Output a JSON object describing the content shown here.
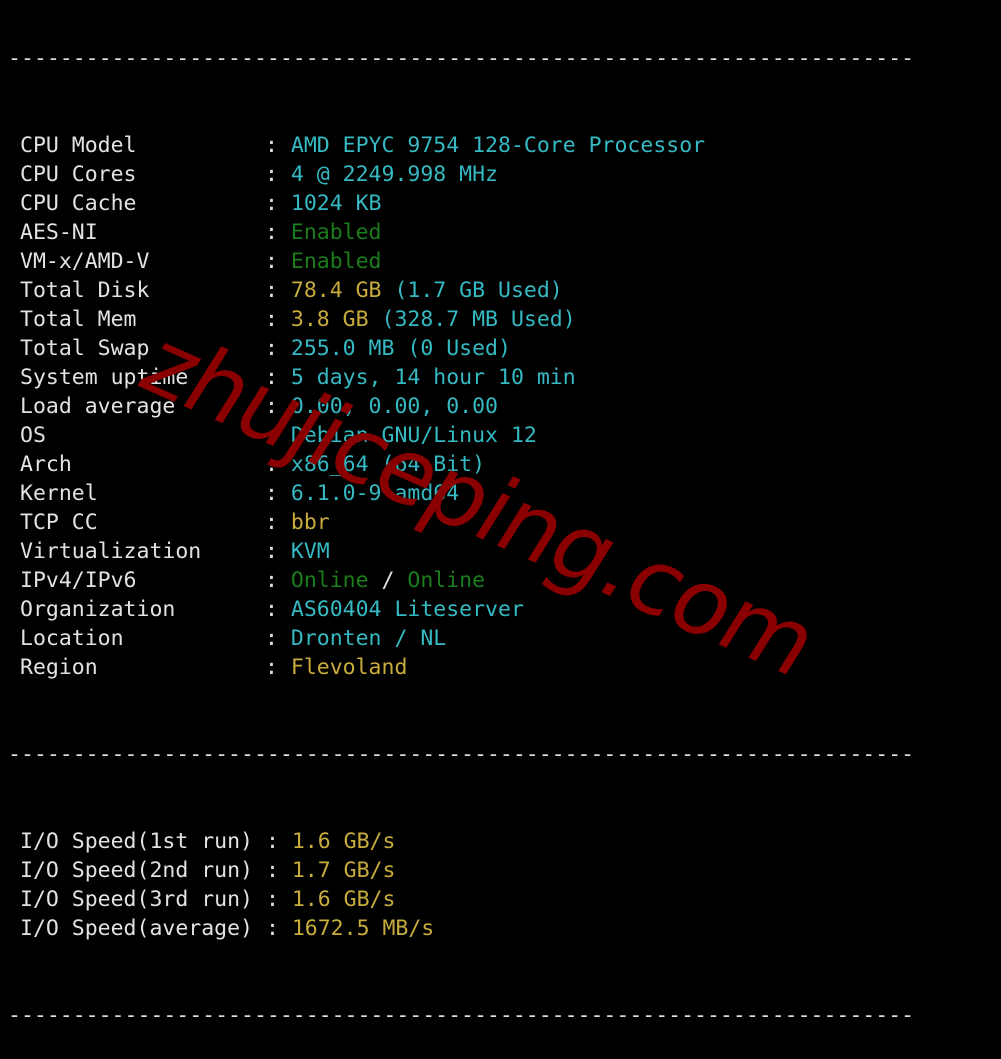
{
  "separator": "----------------------------------------------------------------------",
  "system_info": [
    {
      "label": "CPU Model",
      "segments": [
        {
          "text": "AMD EPYC 9754 128-Core Processor",
          "color": "cyan"
        }
      ]
    },
    {
      "label": "CPU Cores",
      "segments": [
        {
          "text": "4 @ 2249.998 MHz",
          "color": "cyan"
        }
      ]
    },
    {
      "label": "CPU Cache",
      "segments": [
        {
          "text": "1024 KB",
          "color": "cyan"
        }
      ]
    },
    {
      "label": "AES-NI",
      "segments": [
        {
          "text": "Enabled",
          "color": "green"
        }
      ]
    },
    {
      "label": "VM-x/AMD-V",
      "segments": [
        {
          "text": "Enabled",
          "color": "green"
        }
      ]
    },
    {
      "label": "Total Disk",
      "segments": [
        {
          "text": "78.4 GB",
          "color": "yellow"
        },
        {
          "text": " (1.7 GB Used)",
          "color": "cyan"
        }
      ]
    },
    {
      "label": "Total Mem",
      "segments": [
        {
          "text": "3.8 GB",
          "color": "yellow"
        },
        {
          "text": " (328.7 MB Used)",
          "color": "cyan"
        }
      ]
    },
    {
      "label": "Total Swap",
      "segments": [
        {
          "text": "255.0 MB (0 Used)",
          "color": "cyan"
        }
      ]
    },
    {
      "label": "System uptime",
      "segments": [
        {
          "text": "5 days, 14 hour 10 min",
          "color": "cyan"
        }
      ]
    },
    {
      "label": "Load average",
      "segments": [
        {
          "text": "0.00, 0.00, 0.00",
          "color": "cyan"
        }
      ]
    },
    {
      "label": "OS",
      "segments": [
        {
          "text": "Debian GNU/Linux 12",
          "color": "cyan"
        }
      ]
    },
    {
      "label": "Arch",
      "segments": [
        {
          "text": "x86_64 (64 Bit)",
          "color": "cyan"
        }
      ]
    },
    {
      "label": "Kernel",
      "segments": [
        {
          "text": "6.1.0-9-amd64",
          "color": "cyan"
        }
      ]
    },
    {
      "label": "TCP CC",
      "segments": [
        {
          "text": "bbr",
          "color": "yellow"
        }
      ]
    },
    {
      "label": "Virtualization",
      "segments": [
        {
          "text": "KVM",
          "color": "cyan"
        }
      ]
    },
    {
      "label": "IPv4/IPv6",
      "segments": [
        {
          "text": "Online",
          "color": "green"
        },
        {
          "text": " / ",
          "color": "white"
        },
        {
          "text": "Online",
          "color": "green"
        }
      ]
    },
    {
      "label": "Organization",
      "segments": [
        {
          "text": "AS60404 Liteserver",
          "color": "cyan"
        }
      ]
    },
    {
      "label": "Location",
      "segments": [
        {
          "text": "Dronten / NL",
          "color": "cyan"
        }
      ]
    },
    {
      "label": "Region",
      "segments": [
        {
          "text": "Flevoland",
          "color": "yellow"
        }
      ]
    }
  ],
  "io_speed": [
    {
      "label": "I/O Speed(1st run)",
      "value": "1.6 GB/s"
    },
    {
      "label": "I/O Speed(2nd run)",
      "value": "1.7 GB/s"
    },
    {
      "label": "I/O Speed(3rd run)",
      "value": "1.6 GB/s"
    },
    {
      "label": "I/O Speed(average)",
      "value": "1672.5 MB/s"
    }
  ],
  "colon": ": ",
  "colors": {
    "cyan": "#35b9c2",
    "yellow": "#c8ac3c",
    "green": "#1b7d1b",
    "white": "#e2e2e2",
    "watermark": "#8a0000",
    "background": "#000000"
  },
  "watermark": "zhujiceping.com"
}
